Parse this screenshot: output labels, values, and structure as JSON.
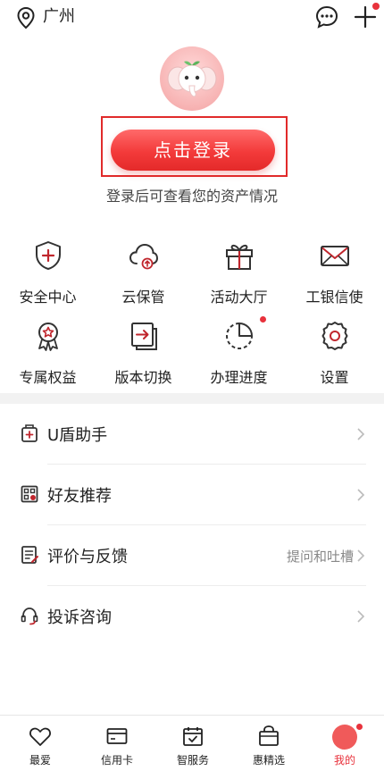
{
  "header": {
    "city": "广州",
    "location_icon": "location-pin-icon",
    "message_icon": "chat-bubble-icon",
    "add_icon": "plus-icon"
  },
  "profile": {
    "avatar_icon": "elephant-avatar-icon",
    "login_label": "点击登录",
    "login_hint": "登录后可查看您的资产情况"
  },
  "services": [
    {
      "label": "安全中心",
      "icon": "shield-plus-icon"
    },
    {
      "label": "云保管",
      "icon": "cloud-upload-icon"
    },
    {
      "label": "活动大厅",
      "icon": "gift-box-icon"
    },
    {
      "label": "工银信使",
      "icon": "envelope-icon"
    },
    {
      "label": "专属权益",
      "icon": "award-ribbon-icon"
    },
    {
      "label": "版本切换",
      "icon": "switch-version-icon"
    },
    {
      "label": "办理进度",
      "icon": "progress-pie-icon",
      "has_badge": true
    },
    {
      "label": "设置",
      "icon": "gear-icon"
    }
  ],
  "menu": [
    {
      "label": "U盾助手",
      "icon": "usb-key-icon",
      "right_text": ""
    },
    {
      "label": "好友推荐",
      "icon": "qr-share-icon",
      "right_text": ""
    },
    {
      "label": "评价与反馈",
      "icon": "feedback-doc-icon",
      "right_text": "提问和吐槽"
    },
    {
      "label": "投诉咨询",
      "icon": "headset-icon",
      "right_text": ""
    }
  ],
  "tabbar": [
    {
      "label": "最爱",
      "icon": "heart-icon"
    },
    {
      "label": "信用卡",
      "icon": "credit-card-icon"
    },
    {
      "label": "智服务",
      "icon": "calendar-check-icon"
    },
    {
      "label": "惠精选",
      "icon": "shopping-bag-icon"
    },
    {
      "label": "我的",
      "icon": "profile-icon",
      "active": true
    }
  ],
  "colors": {
    "accent": "#e8323c",
    "login_gradient_top": "#ff6a6a",
    "login_gradient_bottom": "#e42a2a",
    "icon_stroke": "#333333",
    "muted_text": "#888888"
  }
}
